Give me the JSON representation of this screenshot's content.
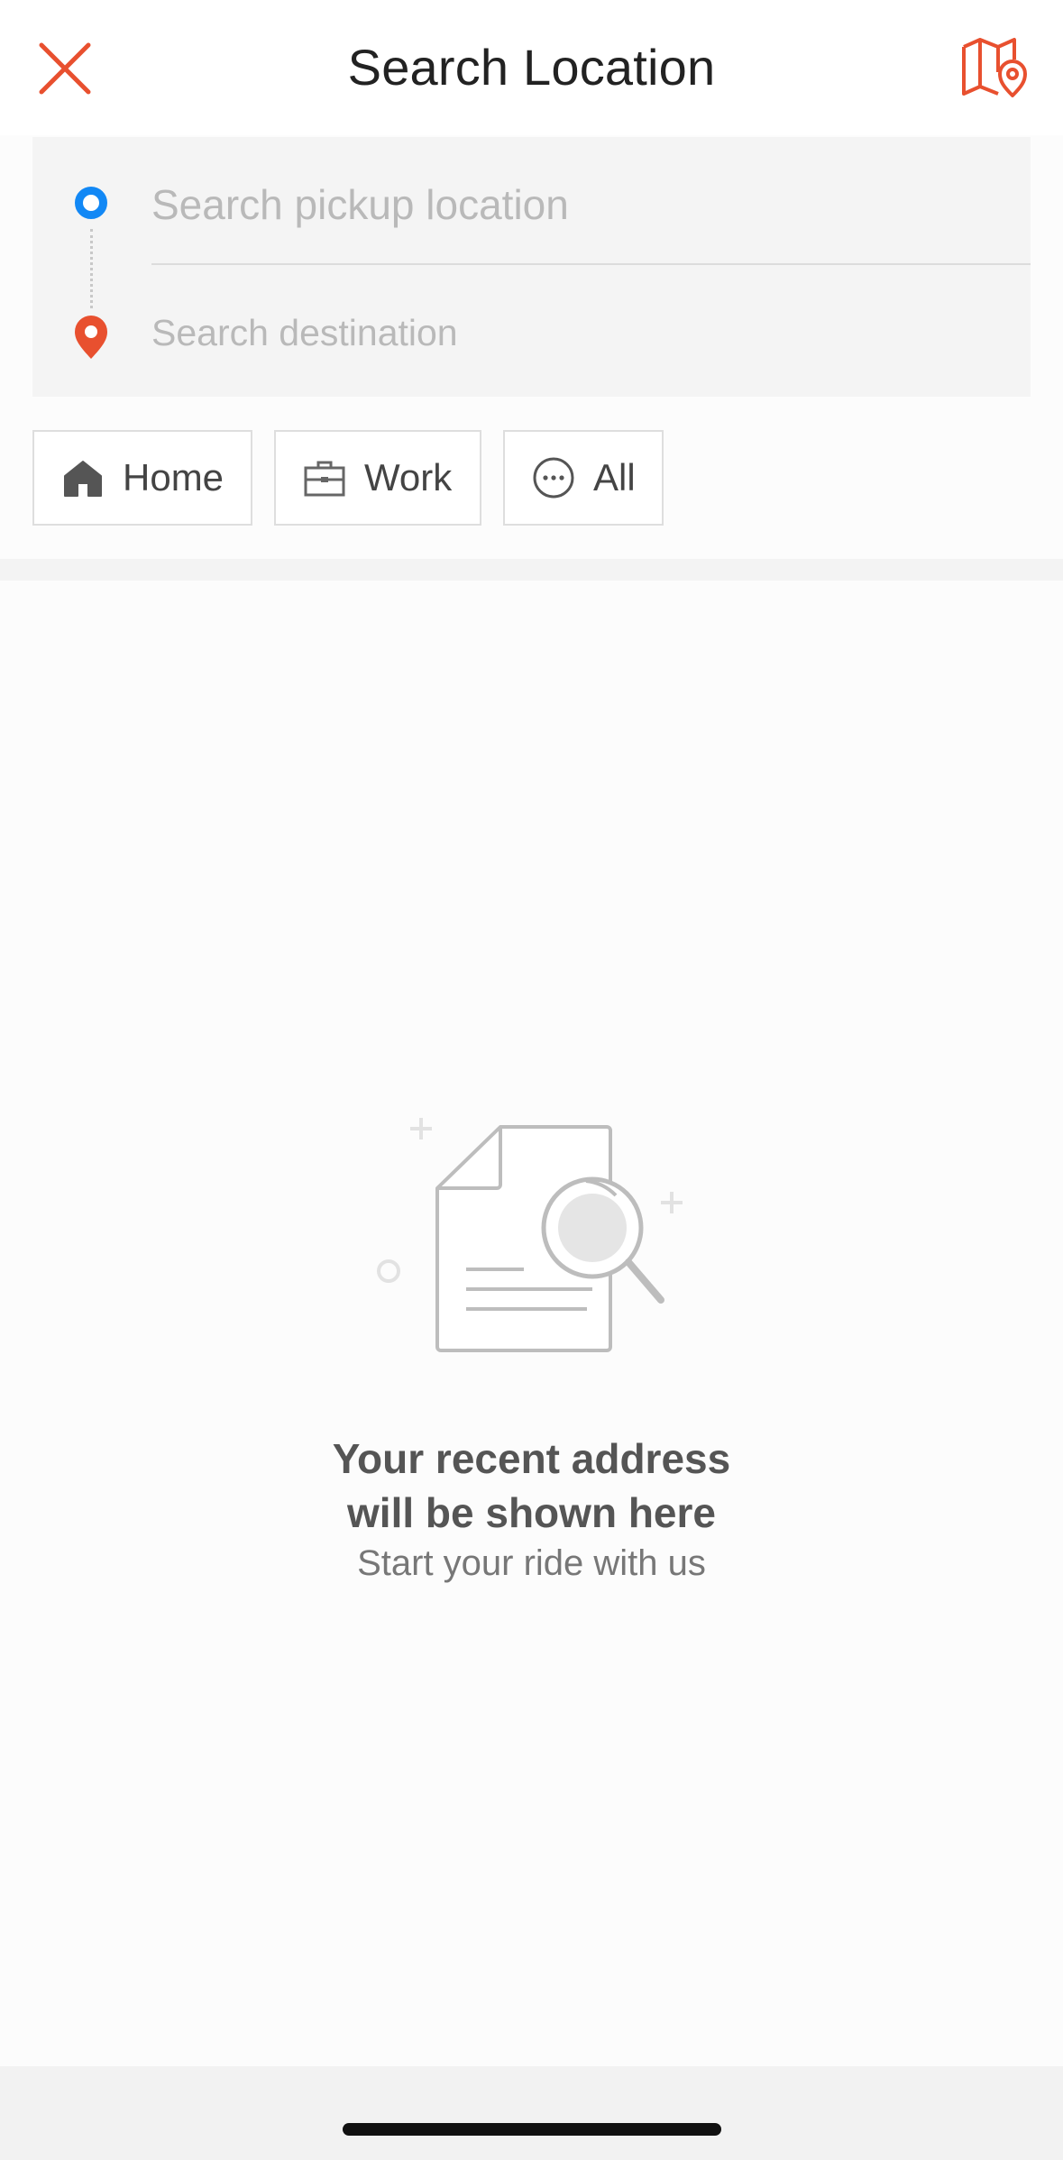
{
  "header": {
    "title": "Search Location"
  },
  "search": {
    "pickup_placeholder": "Search pickup location",
    "destination_placeholder": "Search destination"
  },
  "shortcuts": [
    {
      "label": "Home",
      "icon": "home-icon"
    },
    {
      "label": "Work",
      "icon": "briefcase-icon"
    },
    {
      "label": "All",
      "icon": "more-dots-icon"
    }
  ],
  "empty_state": {
    "title_line1": "Your recent address",
    "title_line2": "will be shown here",
    "subtitle": "Start your ride with us"
  },
  "colors": {
    "accent": "#e8502f",
    "pickup_blue": "#1288f5"
  }
}
